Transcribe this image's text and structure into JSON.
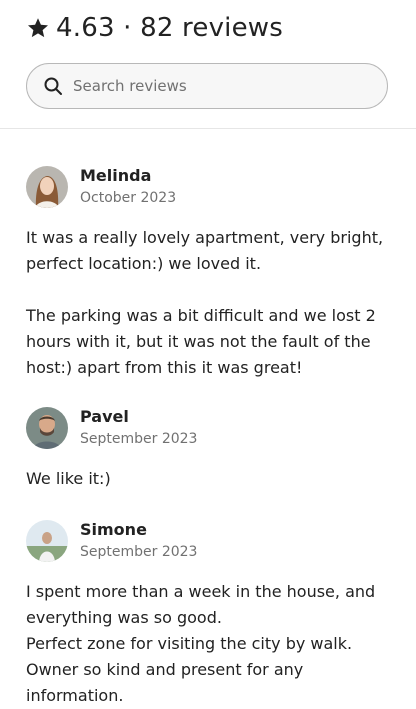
{
  "header": {
    "rating": "4.63",
    "separator": "·",
    "review_count": "82 reviews",
    "search": {
      "placeholder": "Search reviews",
      "value": ""
    }
  },
  "reviews": [
    {
      "name": "Melinda",
      "date": "October 2023",
      "lines": [
        "It was a really lovely apartment, very bright,",
        "perfect location:) we loved it.",
        "The parking was a bit difficult and we lost 2",
        "hours with it, but it was not the fault of the",
        "host:) apart from this it was great!"
      ]
    },
    {
      "name": "Pavel",
      "date": "September 2023",
      "lines": [
        "We like it:)"
      ]
    },
    {
      "name": "Simone",
      "date": "September 2023",
      "lines": [
        "I spent more than a week in the house, and",
        "everything was so good.",
        "Perfect zone for visiting the city by walk.",
        "Owner so kind and present for any",
        "information."
      ]
    }
  ],
  "colors": {
    "text": "#222222",
    "muted": "#717171",
    "divider": "#e6e6e6"
  },
  "icons": {
    "rating": "star-icon",
    "search": "search-icon"
  }
}
